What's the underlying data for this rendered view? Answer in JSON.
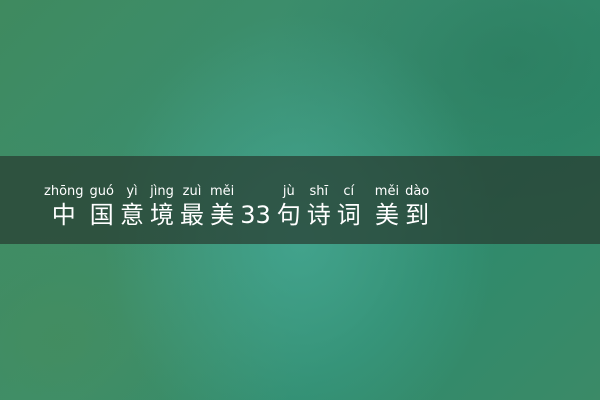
{
  "title": {
    "units": [
      {
        "hanzi": "中",
        "pinyin": "zhōng"
      },
      {
        "hanzi": "国",
        "pinyin": "guó"
      },
      {
        "hanzi": "意",
        "pinyin": "yì"
      },
      {
        "hanzi": "境",
        "pinyin": "jìng"
      },
      {
        "hanzi": "最",
        "pinyin": "zuì"
      },
      {
        "hanzi": "美",
        "pinyin": "měi"
      },
      {
        "hanzi": "33",
        "pinyin": ""
      },
      {
        "hanzi": "句",
        "pinyin": "jù"
      },
      {
        "hanzi": "诗",
        "pinyin": "shī"
      },
      {
        "hanzi": "词",
        "pinyin": "cí"
      },
      {
        "hanzi": "美",
        "pinyin": "měi"
      },
      {
        "hanzi": "到",
        "pinyin": "dào"
      }
    ]
  }
}
